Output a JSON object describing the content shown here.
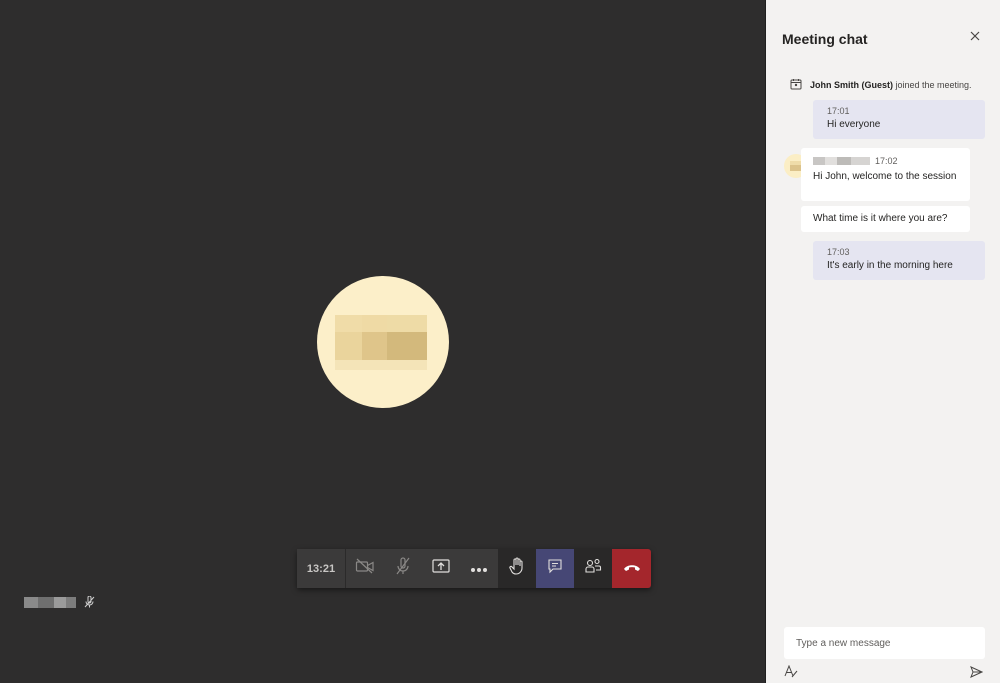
{
  "call": {
    "timer": "13:21",
    "toolbar": {
      "camera_icon": "camera-off-icon",
      "mic_icon": "mic-off-icon",
      "share_icon": "share-screen-icon",
      "more_icon": "more-options-icon",
      "raise_hand_icon": "raise-hand-icon",
      "chat_icon": "chat-icon",
      "participants_icon": "participants-icon",
      "hangup_icon": "hang-up-icon"
    },
    "colors": {
      "stage_bg": "#2e2d2d",
      "active_button": "#464775",
      "hangup": "#a4262c",
      "avatar_bg": "#fcefc9"
    }
  },
  "chat": {
    "title": "Meeting chat",
    "system_message": {
      "name": "John Smith (Guest)",
      "text": " joined the meeting."
    },
    "messages": [
      {
        "from": "me",
        "time": "17:01",
        "text": "Hi everyone"
      },
      {
        "from": "other",
        "time": "17:02",
        "text": "Hi John, welcome to the session"
      },
      {
        "from": "other",
        "time": "",
        "text": "What time is it where you are?"
      },
      {
        "from": "me",
        "time": "17:03",
        "text": "It's early in the morning here"
      }
    ],
    "compose": {
      "placeholder": "Type a new message"
    }
  }
}
